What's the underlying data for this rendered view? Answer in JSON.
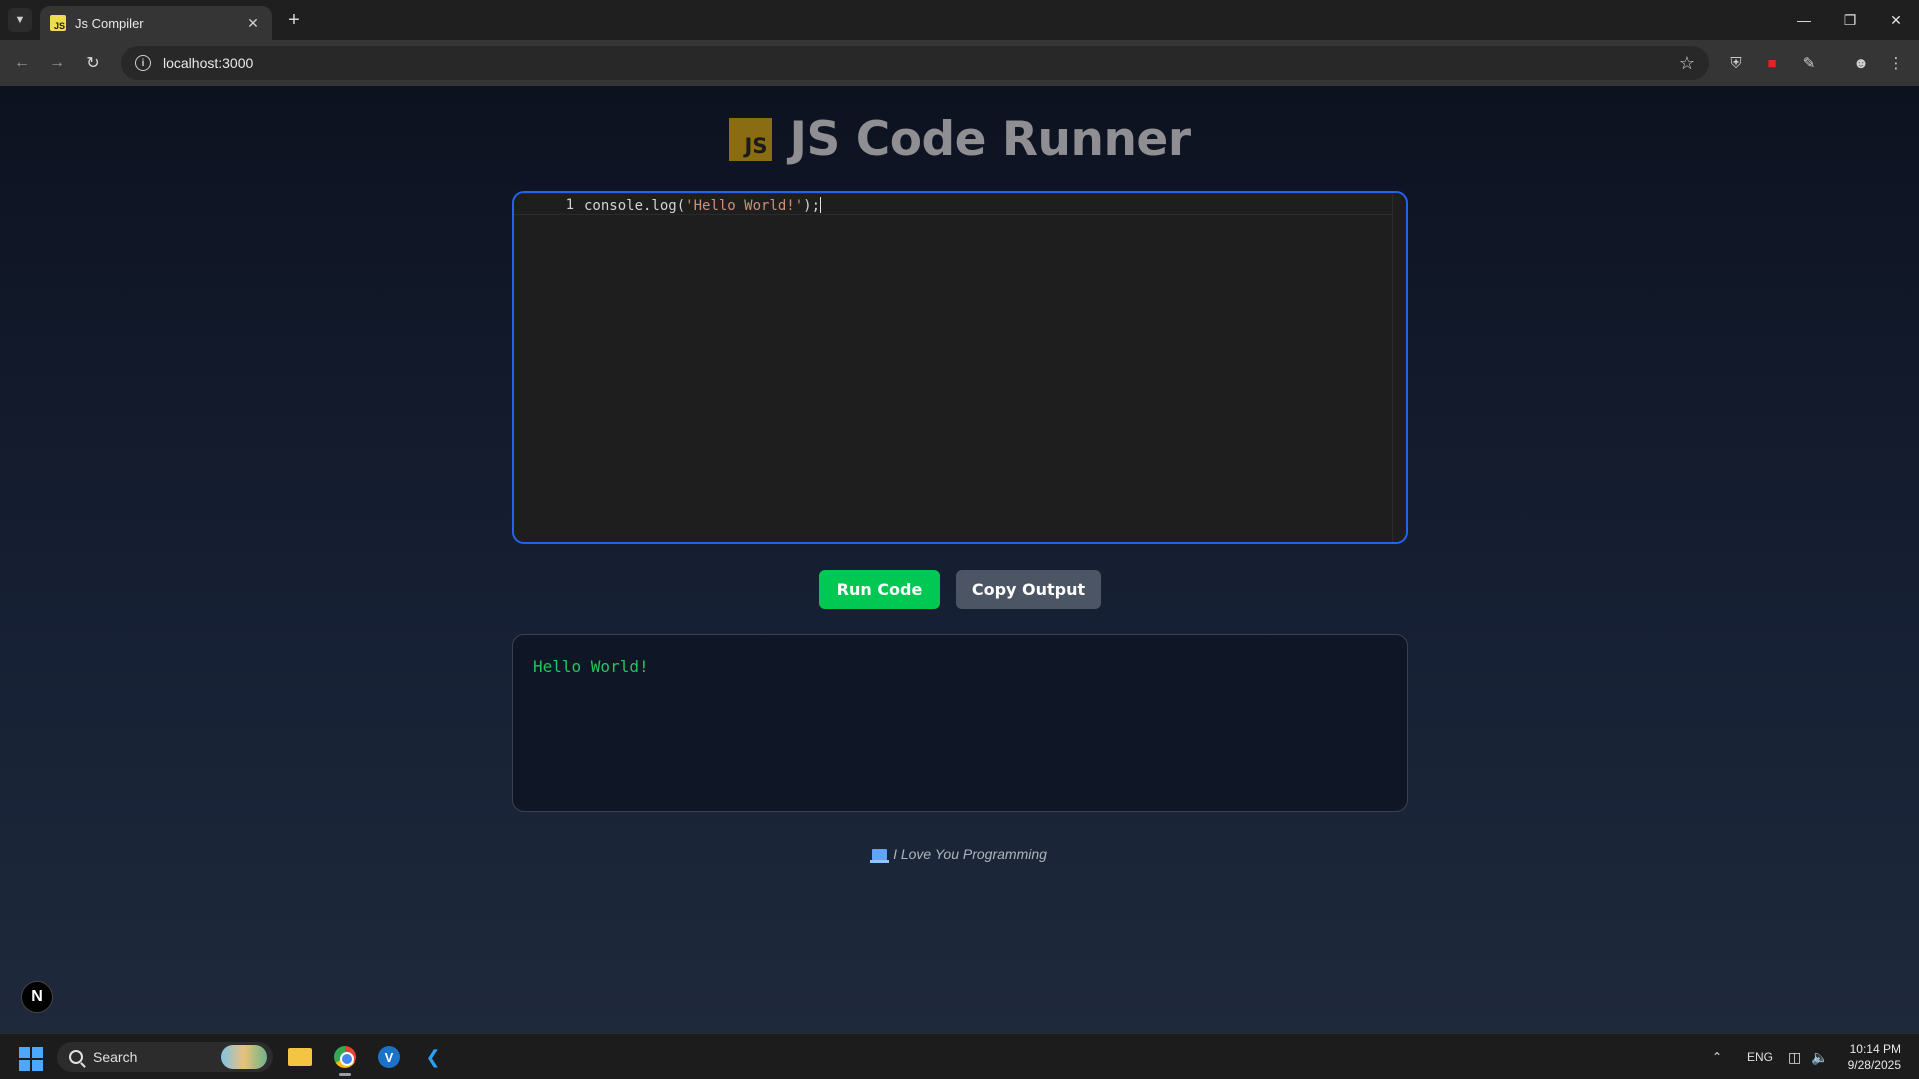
{
  "browser": {
    "tab_title": "Js Compiler",
    "tab_favicon_text": "JS",
    "url": "localhost:3000"
  },
  "header": {
    "logo_text": "JS",
    "title": "JS Code Runner"
  },
  "editor": {
    "line_number": "1",
    "code_prefix": "console.log(",
    "code_string": "'Hello World!'",
    "code_suffix": ");"
  },
  "actions": {
    "run_label": "Run Code",
    "copy_label": "Copy Output"
  },
  "output": {
    "text": "Hello World!"
  },
  "footer": {
    "text": "I Love You Programming"
  },
  "dev_badge": {
    "text": "N"
  },
  "taskbar": {
    "search_label": "Search",
    "language": "ENG",
    "time": "10:14 PM",
    "date": "9/28/2025"
  },
  "colors": {
    "editor_border": "#2563eb",
    "run_button": "#00c853",
    "copy_button": "#4b5563",
    "output_text": "#22c55e"
  }
}
